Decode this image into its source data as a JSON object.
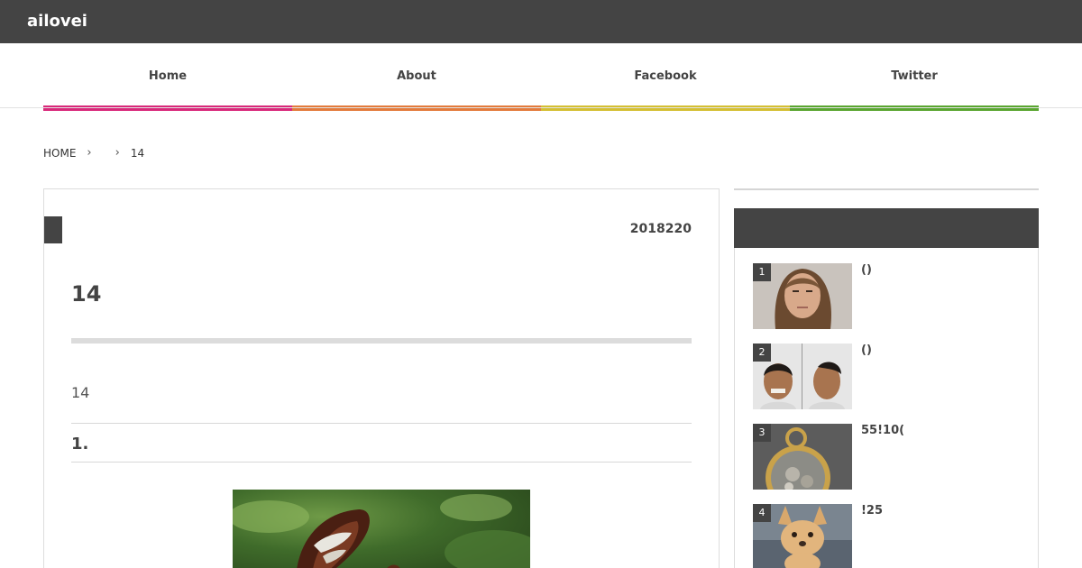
{
  "site": {
    "title": "ailovei"
  },
  "nav": [
    {
      "label": "Home",
      "color": "#d9287a"
    },
    {
      "label": "About",
      "color": "#e37b3c"
    },
    {
      "label": "Facebook",
      "color": "#d4bf32"
    },
    {
      "label": "Twitter",
      "color": "#5aa630"
    }
  ],
  "breadcrumb": {
    "home": "HOME",
    "sep": "›",
    "current": "14"
  },
  "article": {
    "date": "2018220",
    "title": "14",
    "intro": "14",
    "section_heading": "1.",
    "image_icon": "butterfly-image"
  },
  "sidebar": {
    "ranking": [
      {
        "rank": "1",
        "title": "()",
        "thumb": "mugshot-woman"
      },
      {
        "rank": "2",
        "title": "()",
        "thumb": "mugshot-men"
      },
      {
        "rank": "3",
        "title": "55!10(",
        "thumb": "pocket-watch"
      },
      {
        "rank": "4",
        "title": "!25",
        "thumb": "chihuahua-puppy"
      }
    ]
  }
}
